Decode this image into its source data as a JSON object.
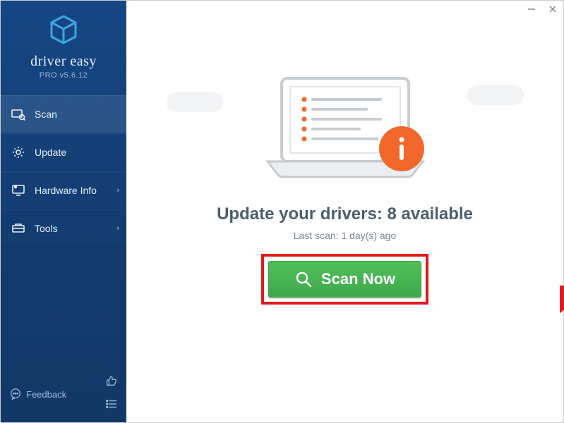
{
  "brand": {
    "name": "driver easy",
    "sub": "PRO v5.6.12"
  },
  "sidebar": {
    "items": [
      {
        "label": "Scan"
      },
      {
        "label": "Update"
      },
      {
        "label": "Hardware Info"
      },
      {
        "label": "Tools"
      }
    ],
    "feedback_label": "Feedback"
  },
  "main": {
    "headline": "Update your drivers: 8 available",
    "subline": "Last scan: 1 day(s) ago",
    "scan_button": "Scan Now"
  }
}
